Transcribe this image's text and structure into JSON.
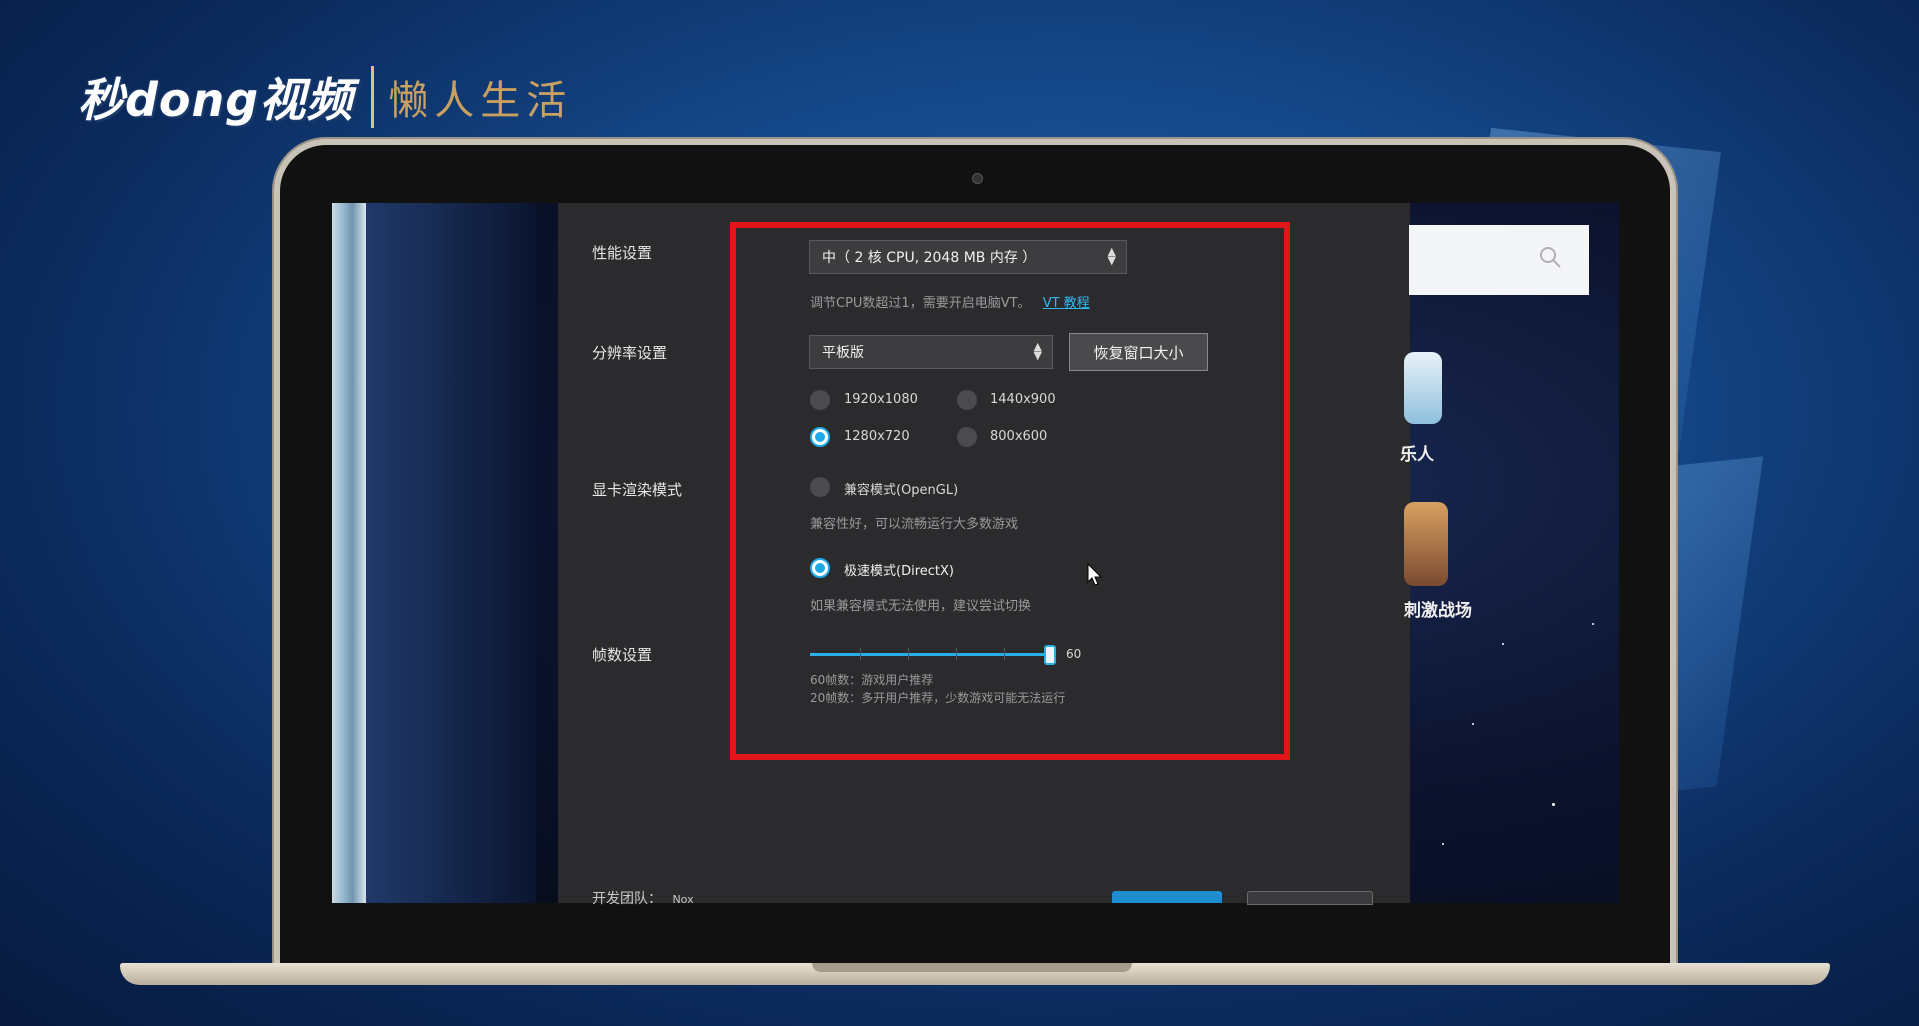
{
  "watermark": {
    "brand": "秒dong视频",
    "sub": "懒人生活"
  },
  "settings": {
    "performance": {
      "label": "性能设置",
      "selected": "中（ 2 核 CPU, 2048 MB 内存 ）",
      "hint_prefix": "调节CPU数超过1，需要开启电脑VT。",
      "hint_link": "VT 教程"
    },
    "resolution": {
      "label": "分辨率设置",
      "selected": "平板版",
      "restore_button": "恢复窗口大小",
      "options": [
        {
          "label": "1920x1080",
          "checked": false
        },
        {
          "label": "1440x900",
          "checked": false
        },
        {
          "label": "1280x720",
          "checked": true
        },
        {
          "label": "800x600",
          "checked": false
        }
      ]
    },
    "render": {
      "label": "显卡渲染模式",
      "opengl_label": "兼容模式(OpenGL)",
      "opengl_checked": false,
      "opengl_hint": "兼容性好，可以流畅运行大多数游戏",
      "directx_label": "极速模式(DirectX)",
      "directx_checked": true,
      "directx_hint": "如果兼容模式无法使用，建议尝试切换"
    },
    "fps": {
      "label": "帧数设置",
      "value": 60,
      "value_text": "60",
      "hint_1": "60帧数：游戏用户推荐",
      "hint_2": "20帧数：多开用户推荐，少数游戏可能无法运行"
    },
    "footer": {
      "team_label": "开发团队：",
      "team_value": "Nox"
    }
  },
  "background_apps": {
    "app1_label": "乐人",
    "app2_label": "刺激战场"
  },
  "colors": {
    "accent": "#1fa9e6",
    "highlight_box": "#e2141c",
    "dialog_bg": "#2b2b2d"
  }
}
